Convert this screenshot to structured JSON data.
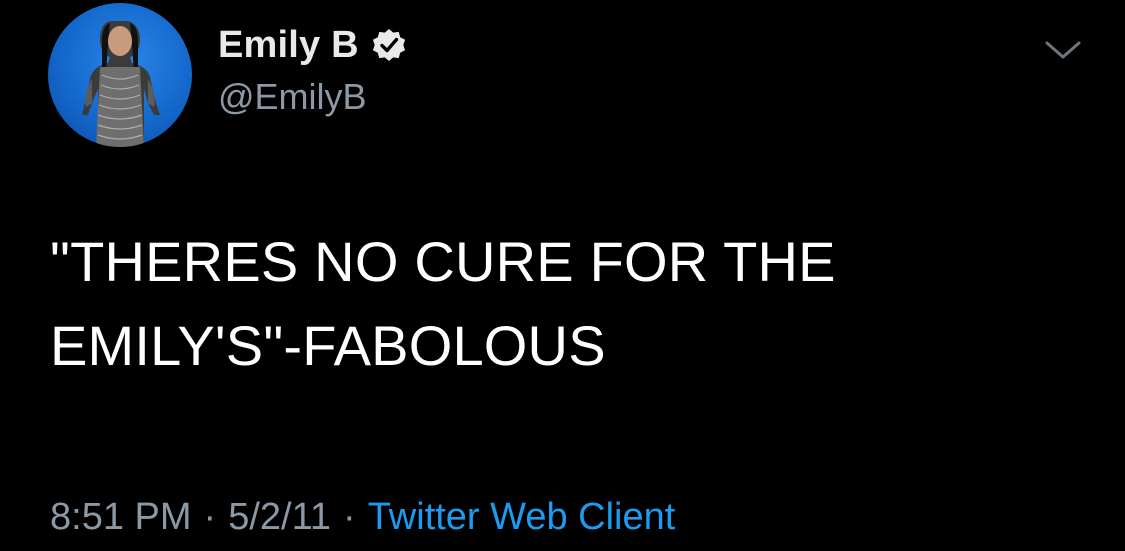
{
  "colors": {
    "background": "#000000",
    "primary_text": "#ffffff",
    "secondary_text": "#8b98a5",
    "link": "#1d9bf0",
    "avatar_background": "#1468cc"
  },
  "author": {
    "display_name": "Emily B",
    "handle": "@EmilyB",
    "verified": true,
    "verified_icon": "verified-badge-icon",
    "avatar_icon": "profile-photo"
  },
  "menu_icon": "chevron-down-icon",
  "tweet": {
    "text_lines": [
      "\"THERES NO CURE FOR THE",
      "EMILY'S\"-FABOLOUS"
    ]
  },
  "meta": {
    "time": "8:51 PM",
    "separator": "·",
    "date": "5/2/11",
    "source": "Twitter Web Client"
  }
}
